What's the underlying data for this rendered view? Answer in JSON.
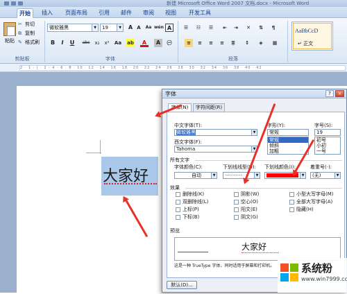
{
  "window": {
    "title": "新建 Microsoft Office Word 2007 文档.docx - Microsoft Word"
  },
  "ribbon": {
    "tabs": [
      {
        "label": "开始",
        "active": true
      },
      {
        "label": "插入"
      },
      {
        "label": "页面布局"
      },
      {
        "label": "引用"
      },
      {
        "label": "邮件"
      },
      {
        "label": "审阅"
      },
      {
        "label": "视图"
      },
      {
        "label": "开发工具"
      }
    ],
    "clipboard": {
      "paste": "粘贴",
      "cut": "剪切",
      "copy": "复制",
      "format_painter": "格式刷",
      "group_label": "剪贴板"
    },
    "font": {
      "font_name": "微软雅黑",
      "font_size": "19",
      "grow": "A",
      "shrink": "A",
      "clear": "Aa",
      "pinyin": "wén",
      "border_char": "A",
      "bold": "B",
      "italic": "I",
      "underline": "U",
      "strike": "abc",
      "subscript": "x₂",
      "superscript": "x²",
      "change_case": "Aa",
      "highlight": "ab",
      "font_color": "A",
      "shade": "A",
      "group_label": "字体"
    },
    "paragraph": {
      "group_label": "段落"
    },
    "styles": {
      "sample": "AaBbCcD",
      "name": "↵ 正文"
    }
  },
  "ruler": {
    "ticks": "2 · 1 · | · 2 · 4 · 6 · 8 · 10 · 12 · 14 · 16 · 18 · 20 · 22 · 24 · 26 · 28 · 30 · 32 · 34 · 36 · 38 · 40 · 42"
  },
  "document": {
    "selected_text": "大家好"
  },
  "font_dialog": {
    "title": "字体",
    "help": "?",
    "close": "×",
    "tabs": {
      "font": "字体(N)",
      "spacing": "字符间距(R)"
    },
    "labels": {
      "chinese_font": "中文字体(T):",
      "style": "字形(Y):",
      "size": "字号(S):",
      "western_font": "西文字体(F):",
      "all_text": "所有文字",
      "font_color": "字体颜色(C):",
      "underline_style": "下划线线型(U):",
      "underline_color": "下划线颜色(I):",
      "emphasis": "着重号(·):",
      "effects": "效果",
      "preview": "预览"
    },
    "values": {
      "chinese_font": "微软雅黑",
      "style": "常规",
      "size": "19",
      "western_font": "Tahoma",
      "font_color": "自动",
      "underline_style": "···········",
      "emphasis": "(无)"
    },
    "style_list": [
      "常规",
      "倾斜",
      "加粗"
    ],
    "size_list": [
      "初号",
      "小初",
      "一号"
    ],
    "effects": {
      "col1": [
        "删除线(K)",
        "双删除线(L)",
        "上标(P)",
        "下标(B)"
      ],
      "col2": [
        "阴影(W)",
        "空心(O)",
        "阳文(E)",
        "阴文(G)"
      ],
      "col3": [
        "小型大写字母(M)",
        "全部大写字母(A)",
        "隐藏(H)"
      ]
    },
    "preview_text": "大家好",
    "preview_note": "这是一种 TrueType 字体，同时适用于屏幕和打印机。",
    "default_button": "默认(D)...",
    "underline_color_hex": "#ff0000"
  },
  "watermark": {
    "text": "系统粉",
    "url": "www.win7999.com"
  },
  "colors": {
    "accent": "#e8302a",
    "selection": "#aac8ea",
    "ribbon": "#dbe7f6"
  }
}
